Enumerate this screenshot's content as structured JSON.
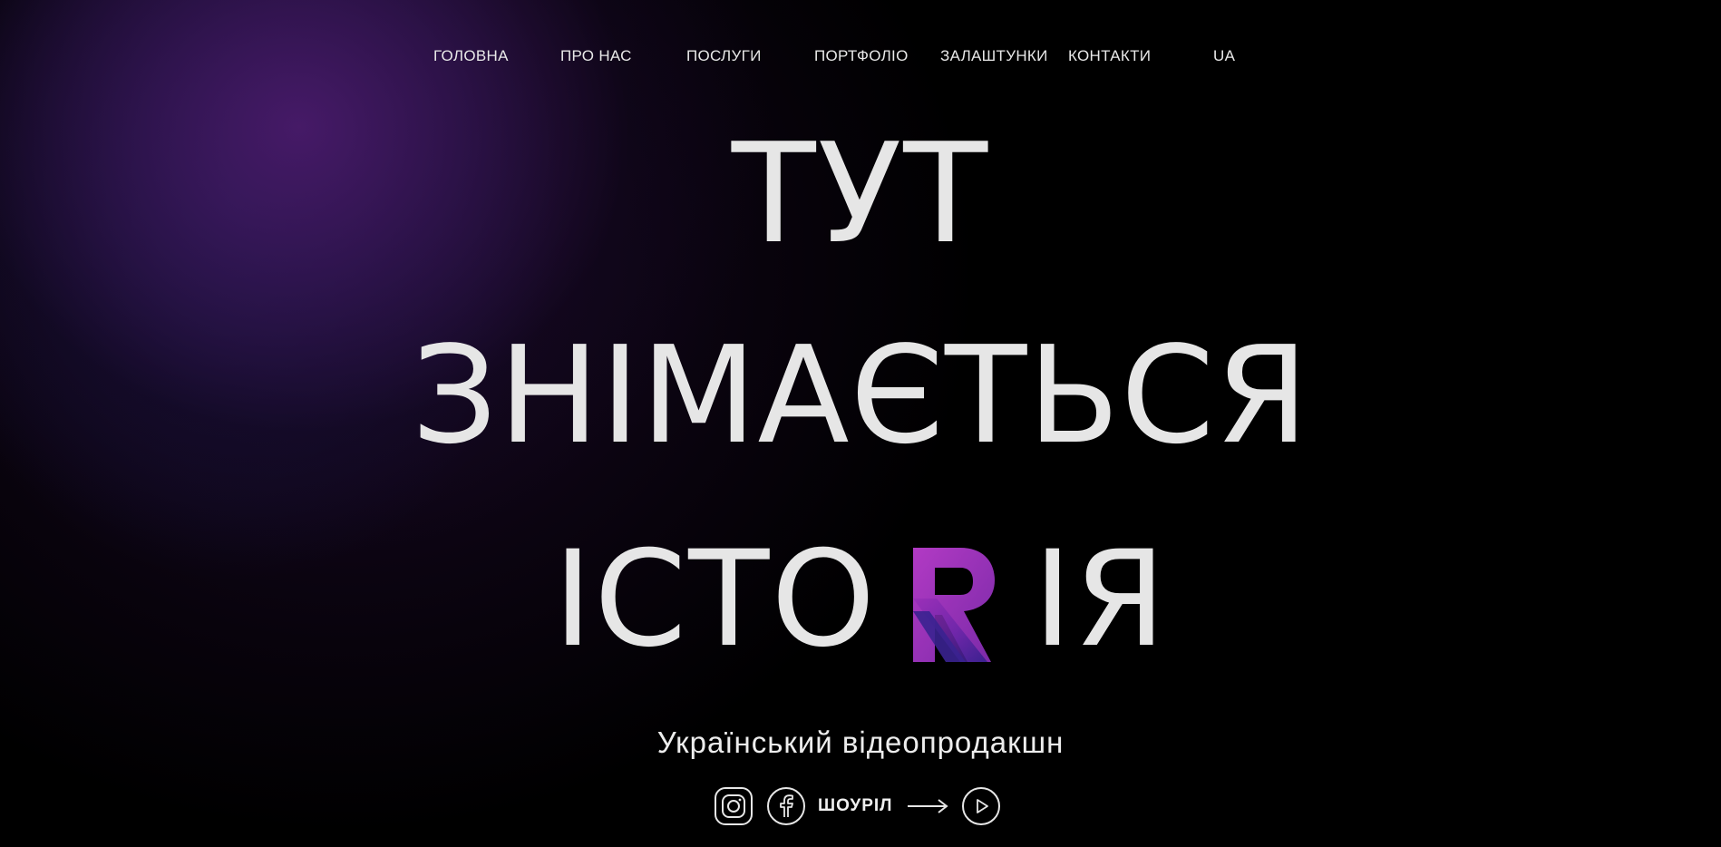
{
  "nav": {
    "items": [
      {
        "label": "ГОЛОВНА"
      },
      {
        "label": "ПРО НАС"
      },
      {
        "label": "ПОСЛУГИ"
      },
      {
        "label": "ПОРТФОЛІО"
      },
      {
        "label": "ЗАЛАШТУНКИ"
      },
      {
        "label": "КОНТАКТИ"
      }
    ],
    "language": "UA"
  },
  "hero": {
    "line1": "ТУТ",
    "line2": "ЗНІМАЄТЬСЯ",
    "line3_before": "ІСТО",
    "line3_after": "ІЯ",
    "subtitle": "Український відеопродакшн"
  },
  "social": {
    "icons": [
      "instagram-icon",
      "facebook-icon",
      "play-icon"
    ],
    "showreel_label": "ШОУРІЛ"
  },
  "colors": {
    "background": "#000000",
    "text": "#e6e6e6",
    "accent_purple": "#8a2bb0",
    "accent_blue": "#3a1f8f"
  }
}
